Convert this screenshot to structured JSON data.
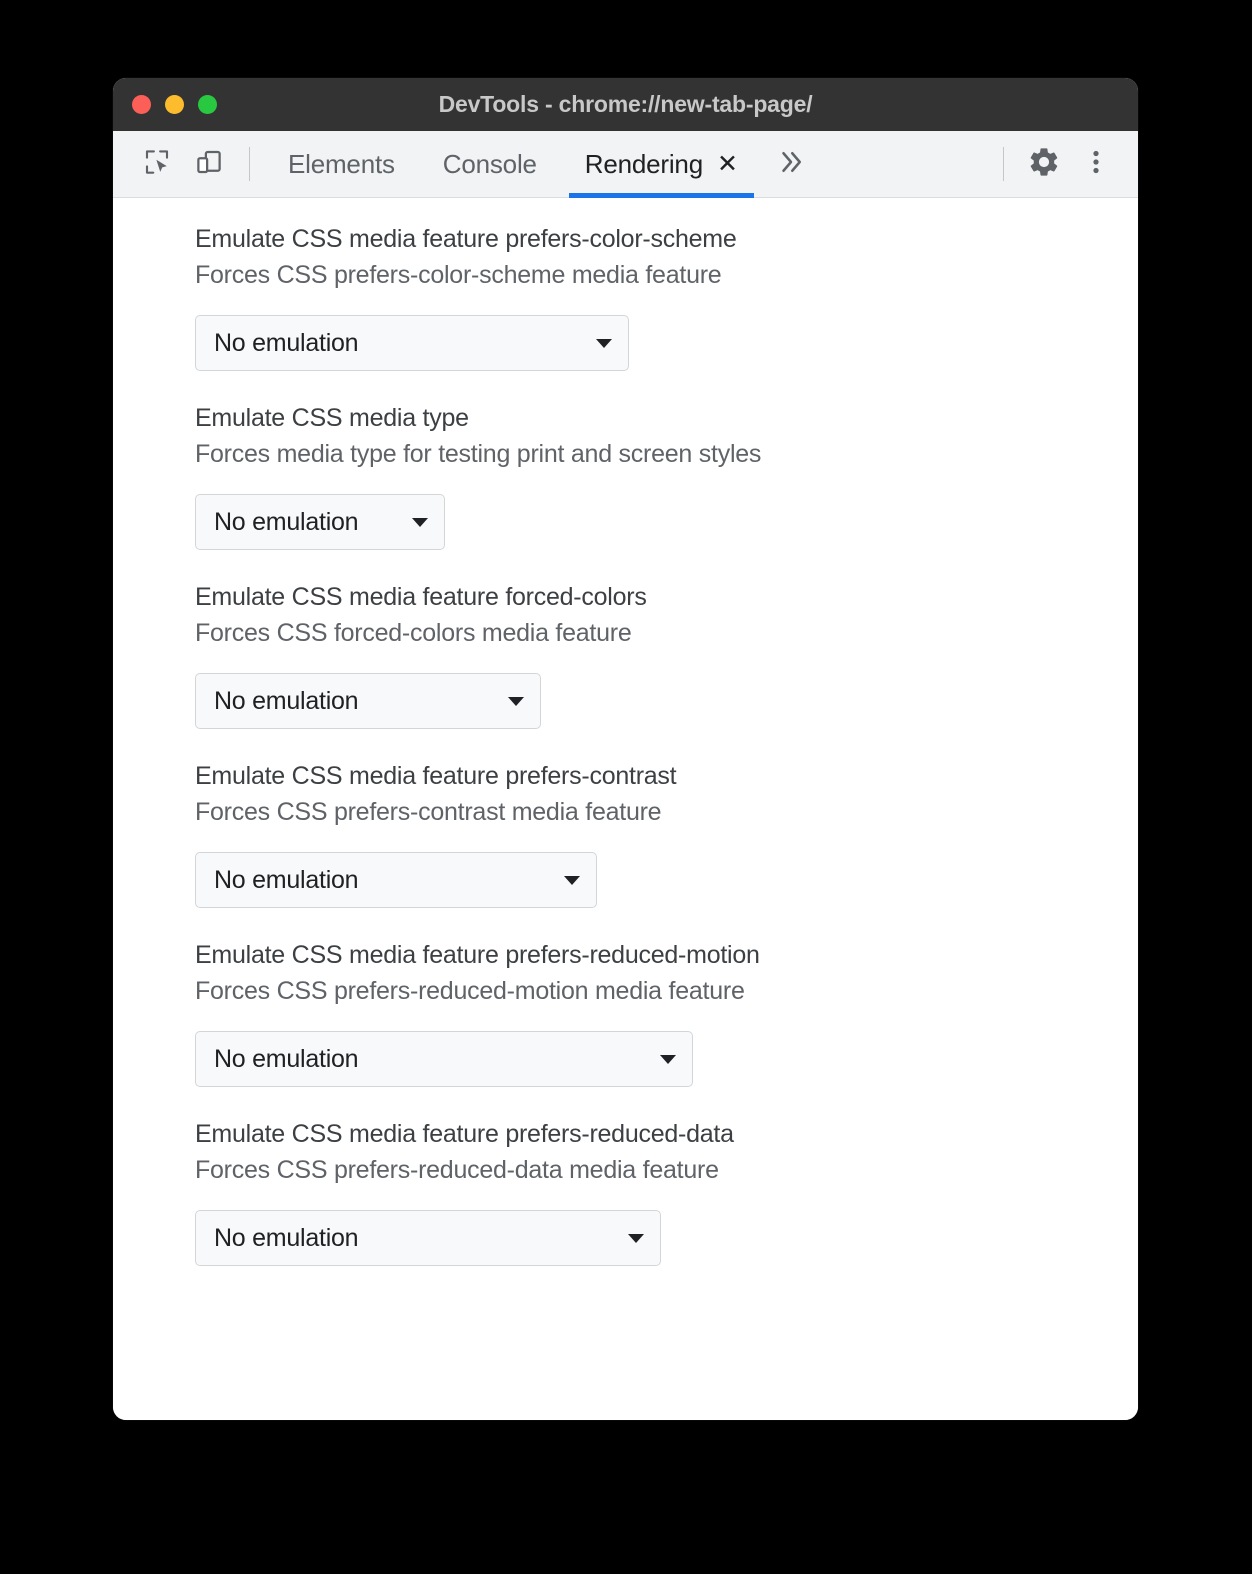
{
  "window": {
    "title": "DevTools - chrome://new-tab-page/",
    "traffic_lights": [
      {
        "name": "close",
        "color": "#FC5F57"
      },
      {
        "name": "minimize",
        "color": "#FDBC2E"
      },
      {
        "name": "maximize",
        "color": "#28C840"
      }
    ]
  },
  "toolbar": {
    "inspect_icon": "inspect-element-icon",
    "device_icon": "device-toolbar-icon",
    "more_tabs_icon": "chevron-double-right-icon",
    "settings_icon": "gear-icon",
    "menu_icon": "kebab-menu-icon"
  },
  "tabs": [
    {
      "label": "Elements",
      "active": false,
      "closable": false
    },
    {
      "label": "Console",
      "active": false,
      "closable": false
    },
    {
      "label": "Rendering",
      "active": true,
      "closable": true,
      "close_glyph": "✕"
    }
  ],
  "accent_color": "#1A73E8",
  "settings": [
    {
      "title": "Emulate CSS media feature prefers-color-scheme",
      "description": "Forces CSS prefers-color-scheme media feature",
      "value": "No emulation"
    },
    {
      "title": "Emulate CSS media type",
      "description": "Forces media type for testing print and screen styles",
      "value": "No emulation"
    },
    {
      "title": "Emulate CSS media feature forced-colors",
      "description": "Forces CSS forced-colors media feature",
      "value": "No emulation"
    },
    {
      "title": "Emulate CSS media feature prefers-contrast",
      "description": "Forces CSS prefers-contrast media feature",
      "value": "No emulation"
    },
    {
      "title": "Emulate CSS media feature prefers-reduced-motion",
      "description": "Forces CSS prefers-reduced-motion media feature",
      "value": "No emulation"
    },
    {
      "title": "Emulate CSS media feature prefers-reduced-data",
      "description": "Forces CSS prefers-reduced-data media feature",
      "value": "No emulation"
    }
  ]
}
